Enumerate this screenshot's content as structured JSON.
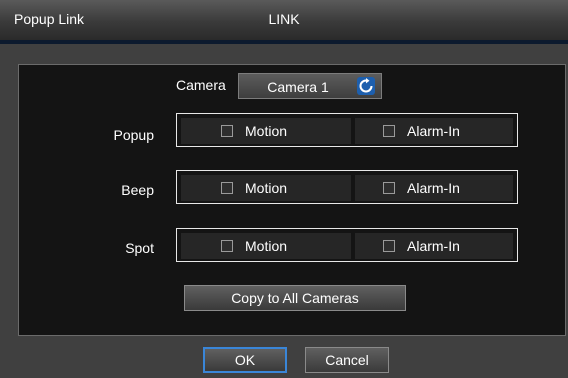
{
  "window": {
    "title": "Popup Link",
    "tab": "LINK"
  },
  "camera": {
    "label": "Camera",
    "value": "Camera 1",
    "icon": "refresh-icon"
  },
  "rows": [
    {
      "label": "Popup",
      "options": [
        {
          "label": "Motion",
          "checked": false
        },
        {
          "label": "Alarm-In",
          "checked": false
        }
      ]
    },
    {
      "label": "Beep",
      "options": [
        {
          "label": "Motion",
          "checked": false
        },
        {
          "label": "Alarm-In",
          "checked": false
        }
      ]
    },
    {
      "label": "Spot",
      "options": [
        {
          "label": "Motion",
          "checked": false
        },
        {
          "label": "Alarm-In",
          "checked": false
        }
      ]
    }
  ],
  "actions": {
    "copy_label": "Copy to All Cameras",
    "ok_label": "OK",
    "cancel_label": "Cancel"
  },
  "colors": {
    "focus": "#3a86d8",
    "refresh_icon": "#2f7fd6"
  }
}
